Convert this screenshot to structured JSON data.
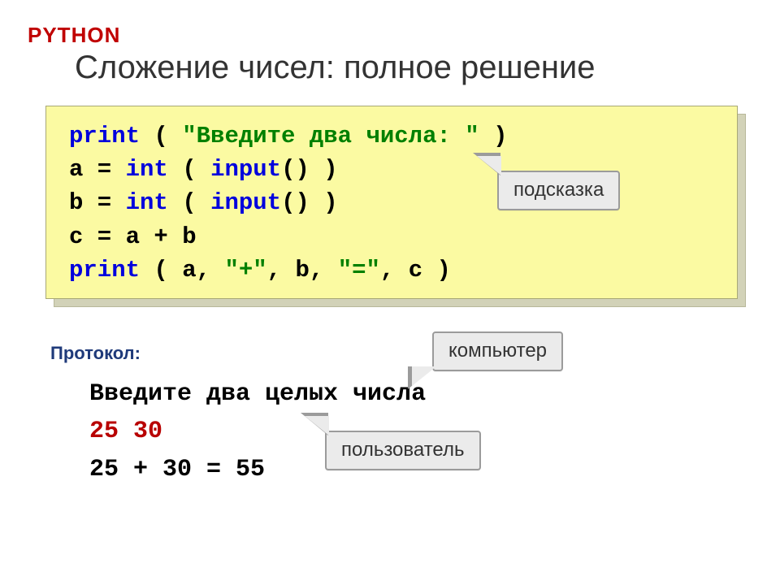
{
  "lang_label": "PYTHON",
  "title": "Сложение чисел: полное решение",
  "code": {
    "l1": {
      "kw": "print",
      "paren_open": " ( ",
      "str": "\"Введите два числа: \"",
      "paren_close": " )"
    },
    "l2": {
      "lhs": "a = ",
      "kw1": "int",
      "open": " ( ",
      "kw2": "input",
      "parens": "()",
      "close": " )"
    },
    "l3": {
      "lhs": "b = ",
      "kw1": "int",
      "open": " ( ",
      "kw2": "input",
      "parens": "()",
      "close": " )"
    },
    "l4": "c = a + b",
    "l5": {
      "kw": "print",
      "open": " ( ",
      "args": "a, ",
      "str1": "\"+\"",
      "sep1": ", b, ",
      "str2": "\"=\"",
      "sep2": ", c ",
      "close": ")"
    }
  },
  "callouts": {
    "hint": "подсказка",
    "computer": "компьютер",
    "user": "пользователь"
  },
  "protocol_heading": "Протокол:",
  "protocol": {
    "prompt": "Введите два целых числа",
    "input": "25 30",
    "output": "25 + 30 = 55"
  }
}
